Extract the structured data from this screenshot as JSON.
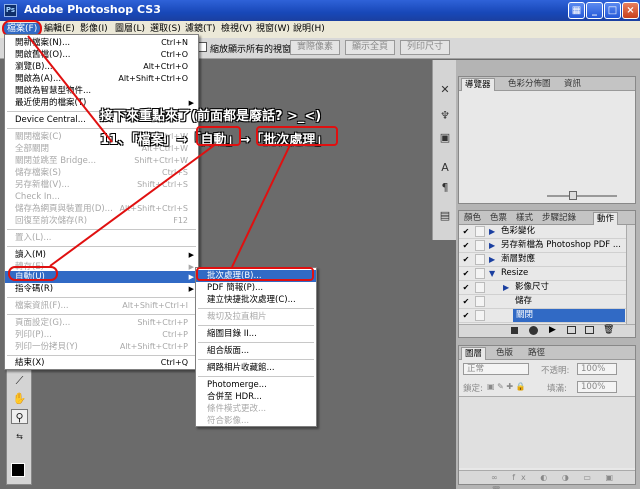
{
  "window": {
    "title": "Adobe Photoshop CS3",
    "app_icon": "Ps",
    "controls": [
      "▦",
      "_",
      "□",
      "×"
    ]
  },
  "menubar": [
    "檔案(F)",
    "編輯(E)",
    "影像(I)",
    "圖層(L)",
    "選取(S)",
    "濾鏡(T)",
    "檢視(V)",
    "視窗(W)",
    "說明(H)"
  ],
  "options_bar": {
    "checkbox_label": "縮放顯示所有的視窗",
    "buttons": [
      "實際像素",
      "顯示全頁",
      "列印尺寸"
    ]
  },
  "file_menu": {
    "items": [
      {
        "label": "開新檔案(N)...",
        "shortcut": "Ctrl+N"
      },
      {
        "label": "開啟舊檔(O)...",
        "shortcut": "Ctrl+O"
      },
      {
        "label": "瀏覽(B)...",
        "shortcut": "Alt+Ctrl+O"
      },
      {
        "label": "開啟為(A)...",
        "shortcut": "Alt+Shift+Ctrl+O"
      },
      {
        "label": "開啟為智慧型物件...",
        "shortcut": ""
      },
      {
        "label": "最近使用的檔案(T)",
        "shortcut": ""
      },
      {
        "label": "Device Central...",
        "shortcut": ""
      },
      {
        "label": "關閉檔案(C)",
        "shortcut": "Ctrl+W"
      },
      {
        "label": "全部關閉",
        "shortcut": "Alt+Ctrl+W"
      },
      {
        "label": "關閉並跳至 Bridge...",
        "shortcut": "Shift+Ctrl+W"
      },
      {
        "label": "儲存檔案(S)",
        "shortcut": "Ctrl+S"
      },
      {
        "label": "另存新檔(V)...",
        "shortcut": "Shift+Ctrl+S"
      },
      {
        "label": "Check In...",
        "shortcut": ""
      },
      {
        "label": "儲存為網頁與裝置用(D)...",
        "shortcut": "Alt+Shift+Ctrl+S"
      },
      {
        "label": "回復至前次儲存(R)",
        "shortcut": "F12"
      },
      {
        "label": "置入(L)...",
        "shortcut": ""
      },
      {
        "label": "讀入(M)",
        "shortcut": ""
      },
      {
        "label": "轉存(E)",
        "shortcut": ""
      },
      {
        "label": "自動(U)",
        "shortcut": ""
      },
      {
        "label": "指令碼(R)",
        "shortcut": ""
      },
      {
        "label": "檔案資訊(F)...",
        "shortcut": "Alt+Shift+Ctrl+I"
      },
      {
        "label": "頁面設定(G)...",
        "shortcut": "Shift+Ctrl+P"
      },
      {
        "label": "列印(P)...",
        "shortcut": "Ctrl+P"
      },
      {
        "label": "列印一份拷貝(Y)",
        "shortcut": "Alt+Shift+Ctrl+P"
      },
      {
        "label": "結束(X)",
        "shortcut": "Ctrl+Q"
      }
    ]
  },
  "automate_submenu": {
    "items": [
      "批次處理(B)...",
      "PDF 簡報(P)...",
      "建立快捷批次處理(C)...",
      "裁切及拉直相片",
      "縮圖目錄 II...",
      "組合版面...",
      "網路相片收藏館...",
      "Photomerge...",
      "合併至 HDR...",
      "條件模式更改...",
      "符合影像..."
    ]
  },
  "annotation": {
    "line1": "接下來重點來了(前面都是廢話? >_<)",
    "line2": "11、「檔案」→「自動」→「批次處理」"
  },
  "panels": {
    "navigator_tabs": [
      "導覽器",
      "色彩分佈圖",
      "資訊"
    ],
    "actions_tabs": [
      "顏色",
      "色票",
      "樣式",
      "步驟記錄",
      "動作"
    ],
    "actions_rows": [
      "色彩變化",
      "另存新檔為 Photoshop PDF ...",
      "漸層對應",
      "Resize",
      "影像尺寸",
      "儲存",
      "關閉"
    ],
    "layers_tabs": [
      "圖層",
      "色版",
      "路徑"
    ],
    "layers_blend": "正常",
    "layers_opacity_label": "不透明:",
    "layers_opacity_value": "100%",
    "layers_lock_label": "鎖定:",
    "layers_fill_label": "填滿:",
    "layers_fill_value": "100%"
  },
  "colors": {
    "accent": "#316ac5",
    "annotation_red": "#e01010"
  }
}
